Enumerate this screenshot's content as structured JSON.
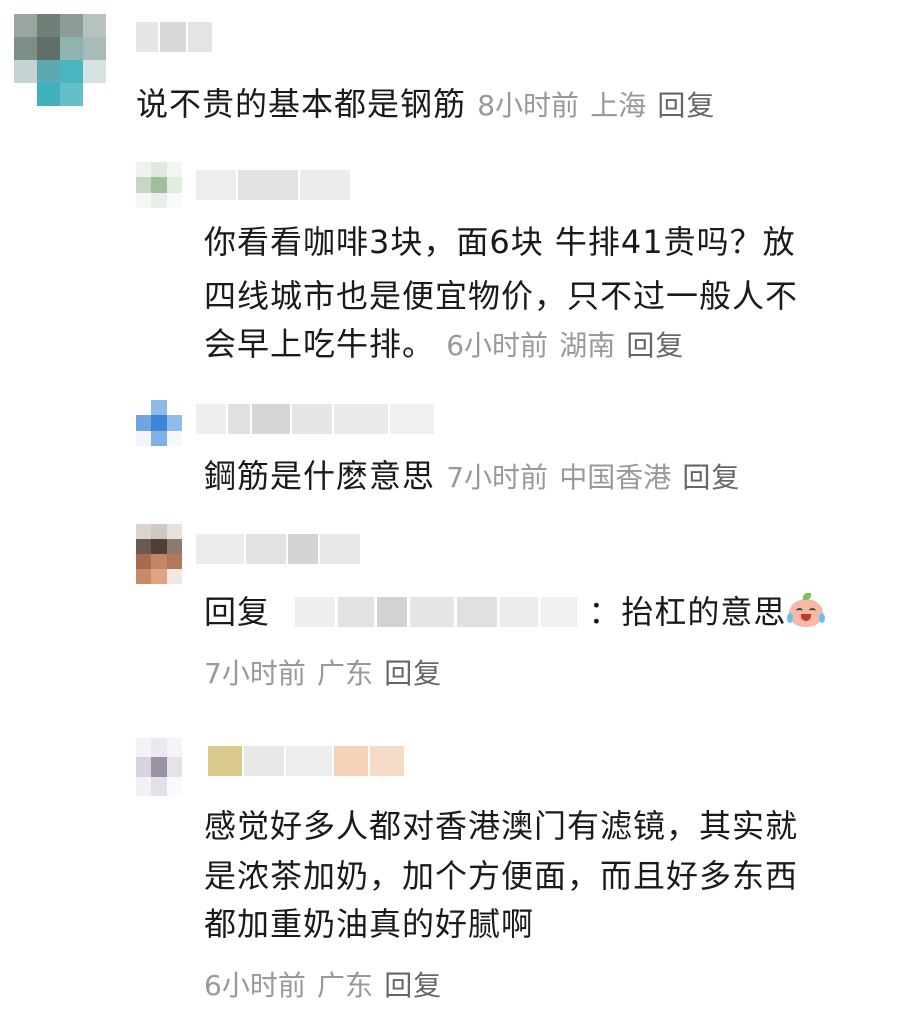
{
  "comments": [
    {
      "text_lines": [
        "说不贵的基本都是钢筋"
      ],
      "time": "8小时前",
      "location": "上海",
      "reply_label": "回复"
    },
    {
      "text_lines": [
        "你看看咖啡3块，面6块 牛排41贵吗？放",
        "四线城市也是便宜物价，只不过一般人不",
        "会早上吃牛排。"
      ],
      "time": "6小时前",
      "location": "湖南",
      "reply_label": "回复"
    },
    {
      "text_lines": [
        "鋼筋是什麽意思"
      ],
      "time": "7小时前",
      "location": "中国香港",
      "reply_label": "回复"
    },
    {
      "reply_prefix": "回复",
      "separator": "：",
      "text": "抬杠的意思",
      "emoji": "crying-laughing-peach-emoji",
      "time": "7小时前",
      "location": "广东",
      "reply_label": "回复"
    },
    {
      "text_lines": [
        "感觉好多人都对香港澳门有滤镜，其实就",
        "是浓茶加奶，加个方便面，而且好多东西",
        "都加重奶油真的好腻啊"
      ],
      "time": "6小时前",
      "location": "广东",
      "reply_label": "回复"
    }
  ],
  "colors": {
    "text": "#1a1a1a",
    "meta": "#999999",
    "reply": "#666666"
  }
}
